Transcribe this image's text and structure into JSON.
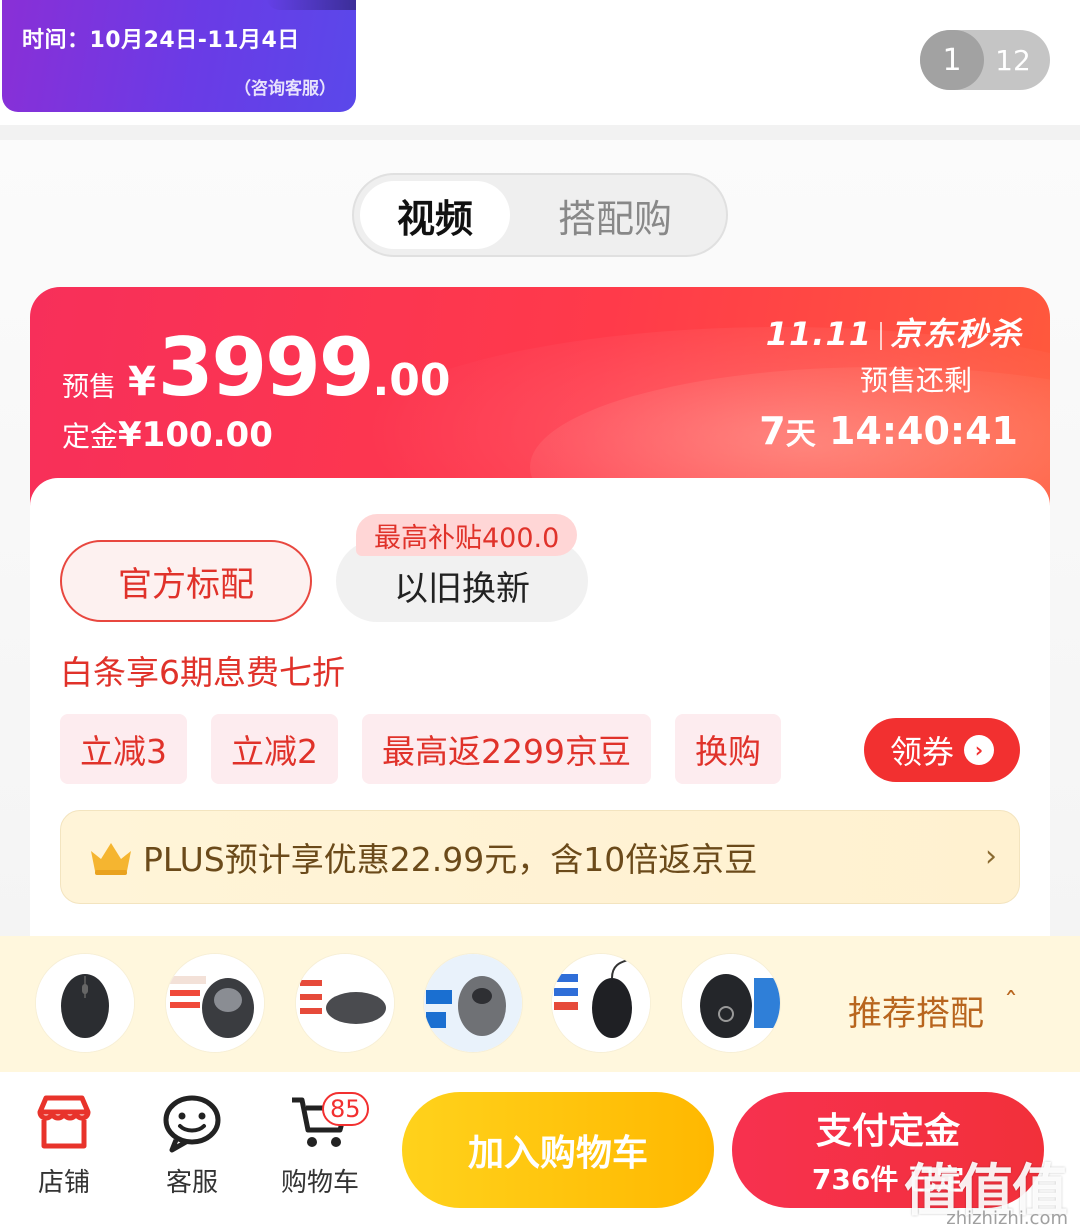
{
  "banner": {
    "time_text": "时间：10月24日-11月4日",
    "consult_text": "（咨询客服）",
    "pager_current": "1",
    "pager_total": "12"
  },
  "tabs": [
    {
      "label": "视频",
      "active": true
    },
    {
      "label": "搭配购",
      "active": false
    }
  ],
  "price": {
    "presale_label": "预售",
    "currency": "¥",
    "integer": "3999",
    "decimal": ".00",
    "deposit_label": "定金",
    "deposit_value": "¥100.00"
  },
  "seckill": {
    "logo_left": "11.11",
    "logo_right": "京东秒杀",
    "remain_label": "预售还剩",
    "countdown_days": "7",
    "countdown_day_unit": "天",
    "countdown_time": "14:40:41"
  },
  "options": {
    "official_label": "官方标配",
    "tradein_label": "以旧换新",
    "subsidy_tag": "最高补贴400.0"
  },
  "baitiao_text": "白条享6期息费七折",
  "coupons": [
    "立减3",
    "立减2",
    "最高返2299京豆",
    "换购"
  ],
  "get_coupon_label": "领券",
  "plus": {
    "text": "PLUS预计享优惠22.99元，含10倍返京豆",
    "chevron": "›"
  },
  "recommend": {
    "label": "推荐搭配",
    "chevron": "ˆ",
    "items": [
      {
        "name": "mouse-thumb-1"
      },
      {
        "name": "mouse-thumb-2"
      },
      {
        "name": "mouse-thumb-3"
      },
      {
        "name": "mouse-thumb-4"
      },
      {
        "name": "mouse-thumb-5"
      },
      {
        "name": "mouse-thumb-6"
      }
    ]
  },
  "bottom_bar": {
    "shop_label": "店铺",
    "service_label": "客服",
    "cart_label": "购物车",
    "cart_badge": "85",
    "add_cart_label": "加入购物车",
    "pay_label": "支付定金",
    "pay_sub": "736件 已定"
  },
  "watermark": {
    "text": "值值值",
    "url": "zhizhizhi.com"
  },
  "colors": {
    "accent_red": "#f23030",
    "cart_yellow": "#ffc107",
    "recommend_text": "#b8651e"
  }
}
